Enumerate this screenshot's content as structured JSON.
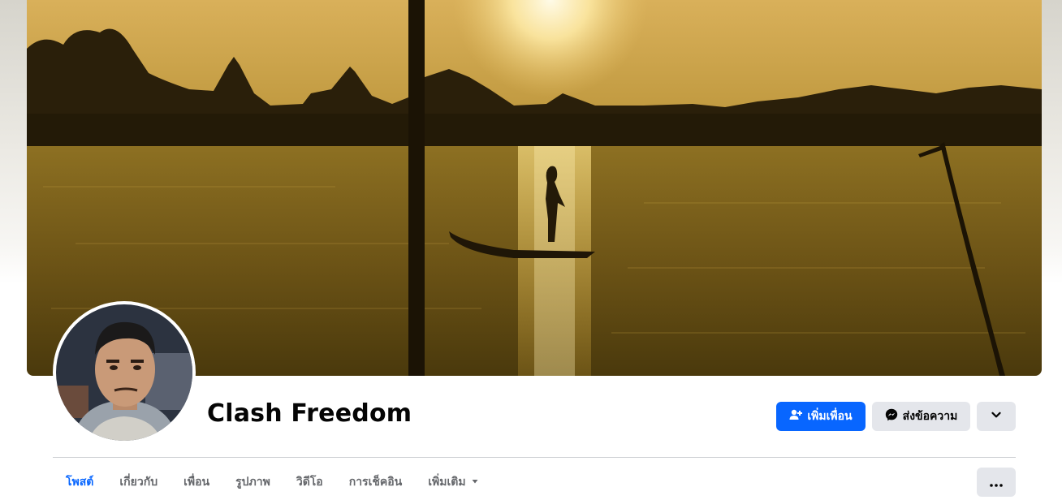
{
  "profile": {
    "name": "Clash Freedom"
  },
  "actions": {
    "add_friend_label": "เพิ่มเพื่อน",
    "message_label": "ส่งข้อความ",
    "add_friend_icon": "person-add-icon",
    "message_icon": "messenger-icon",
    "more_icon": "chevron-down-icon"
  },
  "tabs": [
    {
      "label": "โพสต์",
      "active": true
    },
    {
      "label": "เกี่ยวกับ",
      "active": false
    },
    {
      "label": "เพื่อน",
      "active": false
    },
    {
      "label": "รูปภาพ",
      "active": false
    },
    {
      "label": "วิดีโอ",
      "active": false
    },
    {
      "label": "การเช็คอิน",
      "active": false
    },
    {
      "label": "เพิ่มเติม",
      "active": false
    }
  ],
  "tab_overflow_icon": "ellipsis-icon",
  "colors": {
    "primary": "#0866ff",
    "secondary_button": "#e4e6eb",
    "tab_text": "#65676b",
    "name_text": "#050505"
  }
}
